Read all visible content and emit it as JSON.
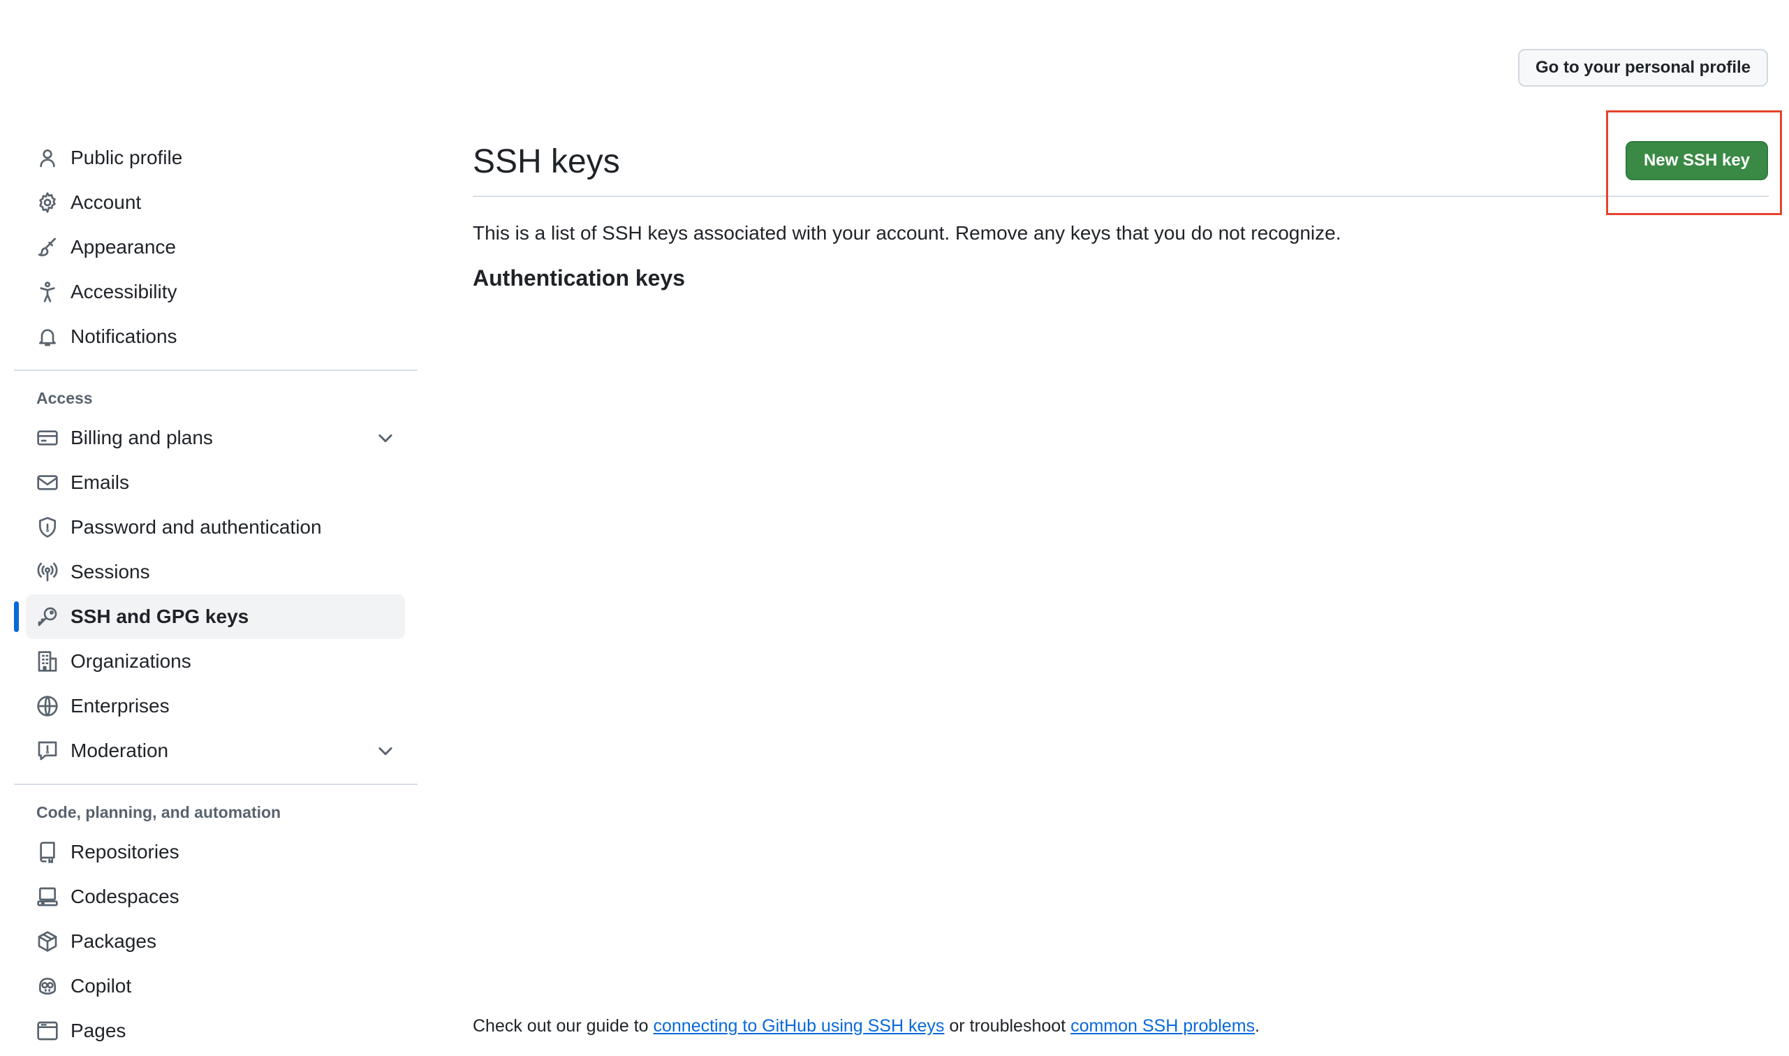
{
  "header": {
    "profile_button": "Go to your personal profile"
  },
  "sidebar": {
    "top_items": [
      {
        "label": "Public profile",
        "icon": "person-icon"
      },
      {
        "label": "Account",
        "icon": "gear-icon"
      },
      {
        "label": "Appearance",
        "icon": "paintbrush-icon"
      },
      {
        "label": "Accessibility",
        "icon": "accessibility-icon"
      },
      {
        "label": "Notifications",
        "icon": "bell-icon"
      }
    ],
    "access_heading": "Access",
    "access_items": [
      {
        "label": "Billing and plans",
        "icon": "credit-card-icon",
        "expandable": true
      },
      {
        "label": "Emails",
        "icon": "mail-icon"
      },
      {
        "label": "Password and authentication",
        "icon": "shield-icon"
      },
      {
        "label": "Sessions",
        "icon": "broadcast-icon"
      },
      {
        "label": "SSH and GPG keys",
        "icon": "key-icon",
        "active": true
      },
      {
        "label": "Organizations",
        "icon": "organization-icon"
      },
      {
        "label": "Enterprises",
        "icon": "globe-icon"
      },
      {
        "label": "Moderation",
        "icon": "report-icon",
        "expandable": true
      }
    ],
    "code_heading": "Code, planning, and automation",
    "code_items": [
      {
        "label": "Repositories",
        "icon": "repo-icon"
      },
      {
        "label": "Codespaces",
        "icon": "codespaces-icon"
      },
      {
        "label": "Packages",
        "icon": "package-icon"
      },
      {
        "label": "Copilot",
        "icon": "copilot-icon"
      },
      {
        "label": "Pages",
        "icon": "browser-icon"
      }
    ]
  },
  "main": {
    "title": "SSH keys",
    "new_key_button": "New SSH key",
    "description": "This is a list of SSH keys associated with your account. Remove any keys that you do not recognize.",
    "auth_heading": "Authentication keys"
  },
  "footer": {
    "prefix": "Check out our guide to ",
    "link1": "connecting to GitHub using SSH keys",
    "middle": " or troubleshoot ",
    "link2": "common SSH problems",
    "suffix": "."
  },
  "colors": {
    "accent_blue": "#0969da",
    "primary_green": "#3a8a45",
    "highlight_red": "#e5432d"
  }
}
